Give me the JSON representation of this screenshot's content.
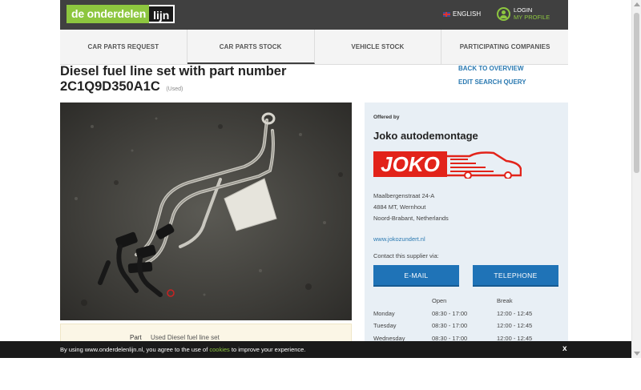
{
  "header": {
    "logo_part1": "de onderdelen",
    "logo_part2": "lijn",
    "language": "ENGLISH",
    "login_line1": "LOGIN",
    "login_line2": "MY PROFILE"
  },
  "nav": {
    "tabs": [
      {
        "label": "CAR PARTS REQUEST"
      },
      {
        "label": "CAR PARTS STOCK"
      },
      {
        "label": "VEHICLE STOCK"
      },
      {
        "label": "PARTICIPATING COMPANIES"
      }
    ]
  },
  "product": {
    "title": "Diesel fuel line set with part number 2C1Q9D350A1C",
    "condition": "(Used)",
    "back_link": "BACK TO OVERVIEW",
    "edit_link": "EDIT SEARCH QUERY",
    "detail_label": "Part",
    "detail_value": "Used Diesel fuel line set"
  },
  "supplier": {
    "offered_by": "Offered by",
    "name": "Joko autodemontage",
    "logo_text": "JOKO",
    "address_line1": "Maalbergenstraat 24-A",
    "address_line2": "4884 MT, Wernhout",
    "address_line3": "Noord-Brabant, Netherlands",
    "website": "www.jokozundert.nl",
    "contact_prompt": "Contact this supplier via:",
    "email_button": "E-MAIL",
    "phone_button": "TELEPHONE",
    "hours": {
      "col_open": "Open",
      "col_break": "Break",
      "rows": [
        {
          "day": "Monday",
          "open": "08:30 - 17:00",
          "break": "12:00 - 12:45"
        },
        {
          "day": "Tuesday",
          "open": "08:30 - 17:00",
          "break": "12:00 - 12:45"
        },
        {
          "day": "Wednesday",
          "open": "08:30 - 17:00",
          "break": "12:00 - 12:45"
        }
      ]
    }
  },
  "cookie_bar": {
    "text_before": "By using www.onderdelenlijn.nl, you agree to the use of ",
    "link": "cookies",
    "text_after": " to improve your experience.",
    "close": "x"
  },
  "colors": {
    "brand_green": "#8dc63f",
    "header_dark": "#404040",
    "button_blue": "#1f73b7",
    "link_blue": "#2a79b1",
    "joko_red": "#e2231a"
  }
}
